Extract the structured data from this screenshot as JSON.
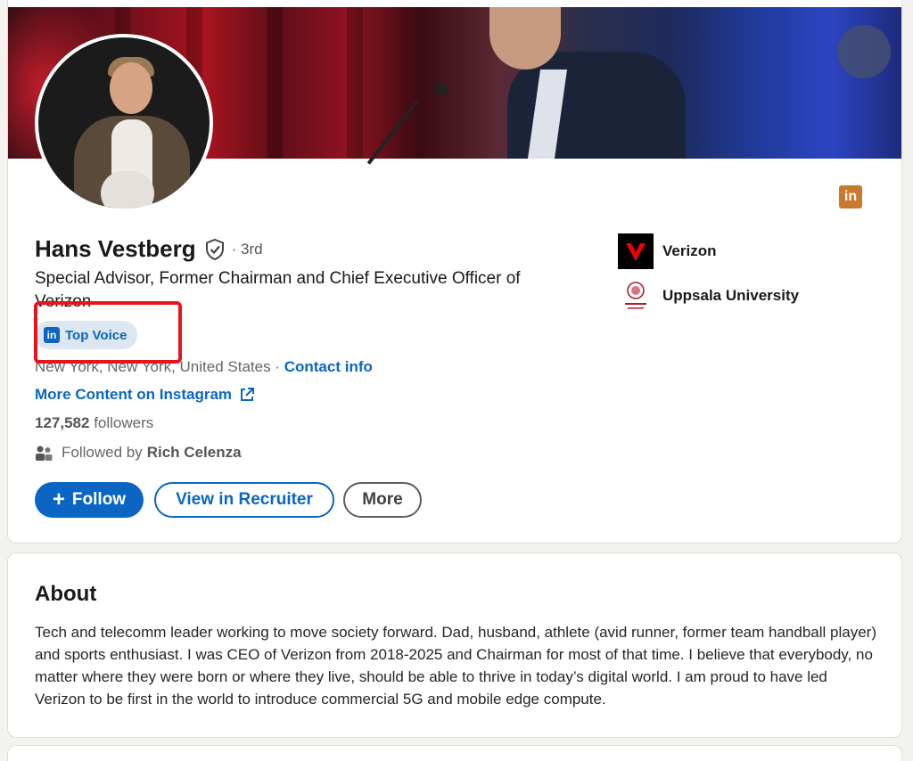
{
  "profile": {
    "name": "Hans Vestberg",
    "degree": "· 3rd",
    "headline": "Special Advisor, Former Chairman and Chief Executive Officer of Verizon",
    "badge": {
      "label": "Top Voice",
      "icon": "linkedin-icon",
      "logo_text": "in"
    },
    "linkedin_logo_text": "in",
    "location": "New York, New York, United States ·",
    "contact_info": "Contact info",
    "external_link": "More Content on Instagram",
    "followers_count": "127,582",
    "followers_label": "followers",
    "followed_by_prefix": "Followed by",
    "followed_by_name": "Rich Celenza",
    "highlight_color": "#e8141b"
  },
  "actions": {
    "follow": "Follow",
    "view_in_recruiter": "View in Recruiter",
    "more": "More"
  },
  "companies": [
    {
      "name": "Verizon",
      "icon": "verizon-logo"
    },
    {
      "name": "Uppsala University",
      "icon": "uppsala-university-logo"
    }
  ],
  "about": {
    "title": "About",
    "body": "Tech and telecomm leader working to move society forward. Dad, husband, athlete (avid runner, former team handball player) and sports enthusiast. I was CEO of Verizon from 2018-2025 and Chairman for most of that time. I believe that everybody, no matter where they were born or where they live, should be able to thrive in today’s digital world. I am proud to have led Verizon to be first in the world to introduce commercial 5G and mobile edge compute."
  },
  "colors": {
    "accent": "#0a66c2",
    "badge_bg": "#dde7f1",
    "linkedin_orange": "#c97a2c",
    "verizon_red": "#ee0000"
  }
}
